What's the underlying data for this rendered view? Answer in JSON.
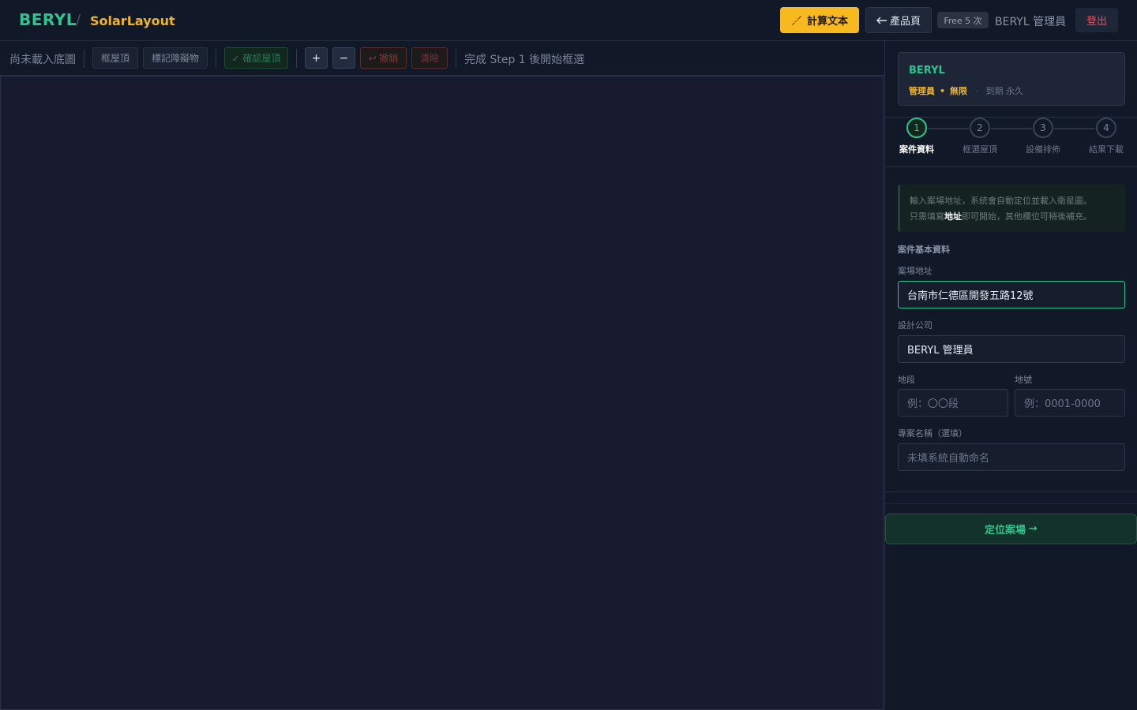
{
  "header": {
    "brand": "BERYL",
    "separator": "/",
    "app_name": "SolarLayout",
    "calc_button": {
      "icon": "ruler-icon",
      "label": "計算文本"
    },
    "product_button": {
      "icon": "arrow-left-icon",
      "label": "產品頁"
    },
    "free_badge": "Free 5 次",
    "user_name": "BERYL 管理員",
    "logout_label": "登出"
  },
  "toolbar": {
    "status": "尚未載入底圖",
    "frame_roof": "框屋頂",
    "mark_obstacle": "標記障礙物",
    "confirm_roof": "✓ 確認屋頂",
    "zoom_in": "+",
    "zoom_out": "−",
    "undo": "↩ 撤銷",
    "clear": "清除",
    "hint": "完成 Step 1 後開始框選"
  },
  "panel": {
    "plan": {
      "name": "BERYL",
      "role": "管理員",
      "dot": "•",
      "quota": "無限",
      "sep": "·",
      "expiry": "到期 永久"
    },
    "steps": [
      {
        "num": "1",
        "label": "案件資料"
      },
      {
        "num": "2",
        "label": "框選屋頂"
      },
      {
        "num": "3",
        "label": "設備排佈"
      },
      {
        "num": "4",
        "label": "結果下載"
      }
    ],
    "info": {
      "line1": "輸入案場地址，系統會自動定位並載入衛星圖。",
      "line2_pre": "只需填寫",
      "line2_bold": "地址",
      "line2_post": "即可開始，其他欄位可稍後補充。"
    },
    "section_title": "案件基本資料",
    "fields": {
      "address": {
        "label": "案場地址",
        "value": "台南市仁德區開發五路12號"
      },
      "company": {
        "label": "設計公司",
        "value": "BERYL 管理員"
      },
      "section": {
        "label": "地段",
        "placeholder": "例：〇〇段"
      },
      "lot": {
        "label": "地號",
        "placeholder": "例：0001-0000"
      },
      "project": {
        "label": "專案名稱（選填）",
        "placeholder": "未填系統自動命名"
      }
    },
    "locate_button": {
      "label": "定位案場",
      "icon": "arrow-right-icon",
      "arrow": "→"
    }
  },
  "colors": {
    "brand_green": "#2fc48d",
    "accent_gold": "#f0b429",
    "calc_yellow": "#f8b820",
    "danger_red": "#f04a5a",
    "canvas_bg": "#181b2f",
    "chrome_bg": "#111827"
  }
}
